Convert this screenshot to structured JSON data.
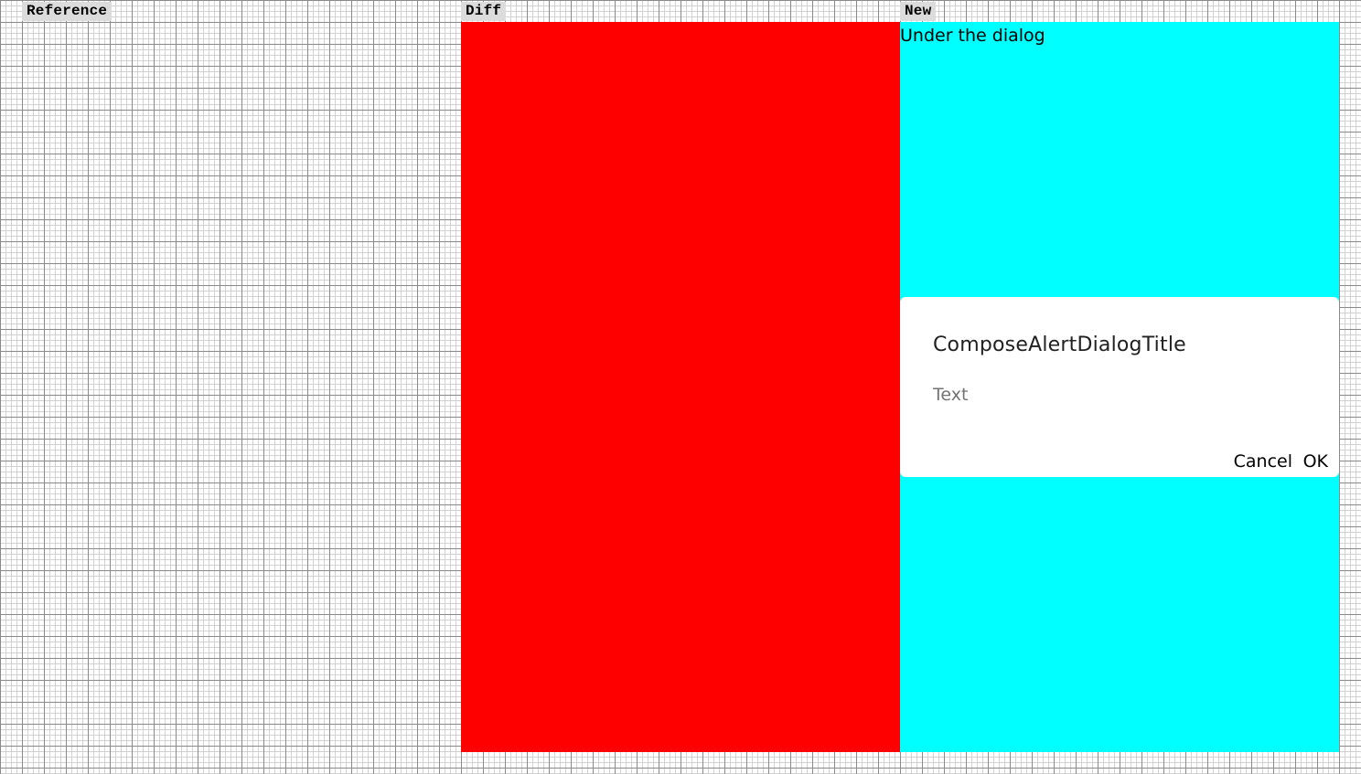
{
  "labels": {
    "reference": "Reference",
    "diff": "Diff",
    "new": "New"
  },
  "new_panel": {
    "under_text": "Under the dialog",
    "dialog": {
      "title": "ComposeAlertDialogTitle",
      "text": "Text",
      "cancel_label": "Cancel",
      "ok_label": "OK"
    }
  },
  "colors": {
    "diff_fill": "#ff0000",
    "new_background": "#00ffff",
    "dialog_background": "#ffffff"
  }
}
